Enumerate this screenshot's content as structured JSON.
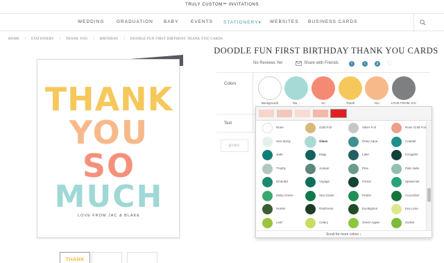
{
  "header": {
    "brand": "TRULY CUSTOM™ INVITATIONS"
  },
  "nav": {
    "items": [
      "WEDDING",
      "GRADUATION",
      "BABY",
      "EVENTS",
      "STATIONERY",
      "WEBSITES",
      "BUSINESS CARDS"
    ],
    "active": "STATIONERY",
    "active_suffix": "▾",
    "search_icon": "search-icon"
  },
  "breadcrumb": [
    "HOME",
    "/",
    "STATIONERY",
    "/",
    "THANK YOU",
    "/",
    "BIRTHDAY",
    "/",
    "DOODLE FUN FIRST BIRTHDAY THANK YOU CARDS"
  ],
  "card": {
    "line1": "THANK",
    "line2": "YOU",
    "line3": "SO",
    "line4": "MUCH",
    "signoff": "LOVE FROM JAC & BLAKE"
  },
  "thumbnails": {
    "first": "THANK"
  },
  "product": {
    "title": "DOODLE FUN FIRST BIRTHDAY THANK YOU CARDS",
    "reviews": "No Reviews Yet",
    "share": "Share with Friends",
    "social": [
      "f",
      "t",
      "p"
    ],
    "favorite_icon": "heart-icon"
  },
  "options": {
    "colors_label": "Colors",
    "text_label": "Text",
    "prev_label": "prev",
    "swatches": [
      {
        "label": "Background",
        "color": "#ffffff"
      },
      {
        "label": "Mu...",
        "color": "#a5dad6"
      },
      {
        "label": "So",
        "color": "#f48a74"
      },
      {
        "label": "Thank",
        "color": "#f6c85c"
      },
      {
        "label": "You",
        "color": "#f8b98a"
      },
      {
        "label": "LOVE FROM JAC",
        "color": "#7d7f80"
      }
    ]
  },
  "picker": {
    "strip_colors": [
      "#f6d5cc",
      "#f3c8bc",
      "#f7dcd2",
      "#f2b9a8",
      "#e41d23"
    ],
    "colors": [
      {
        "name": "None",
        "color": "#ffffff",
        "bold": false
      },
      {
        "name": "Gold Foil",
        "color": "#d8b97a",
        "bold": false
      },
      {
        "name": "Silver Foil",
        "color": "#c7c7c7",
        "bold": false
      },
      {
        "name": "Rose Gold Foil",
        "color": "#eba08a",
        "bold": false
      },
      {
        "name": "Sea Spray",
        "color": "#e4f1ea",
        "bold": false
      },
      {
        "name": "Glass",
        "color": "#a5dad6",
        "bold": true
      },
      {
        "name": "Deep Aqua",
        "color": "#3d8f94",
        "bold": false
      },
      {
        "name": "Coastal",
        "color": "#1e8f8b",
        "bold": false
      },
      {
        "name": "Jade",
        "color": "#0f7e76",
        "bold": false
      },
      {
        "name": "Edgy",
        "color": "#13625d",
        "bold": false
      },
      {
        "name": "Lake",
        "color": "#245e62",
        "bold": false
      },
      {
        "name": "Incognito",
        "color": "#133f3c",
        "bold": false
      },
      {
        "name": "Trophy",
        "color": "#b1c7c1",
        "bold": false
      },
      {
        "name": "Juniper",
        "color": "#5e867c",
        "bold": false
      },
      {
        "name": "Pine",
        "color": "#6a9b8c",
        "bold": false
      },
      {
        "name": "Pale Jade",
        "color": "#90c2ae",
        "bold": false
      },
      {
        "name": "Emerald",
        "color": "#1b8a6e",
        "bold": false
      },
      {
        "name": "Voyage",
        "color": "#0f6e5a",
        "bold": false
      },
      {
        "name": "Forest",
        "color": "#154335",
        "bold": false
      },
      {
        "name": "Spearmint",
        "color": "#2aa379",
        "bold": false
      },
      {
        "name": "Minty Green",
        "color": "#38a86d",
        "bold": false
      },
      {
        "name": "Sea Grass",
        "color": "#0f7a4a",
        "bold": false
      },
      {
        "name": "Prairie",
        "color": "#1f9154",
        "bold": false
      },
      {
        "name": "Cucumber",
        "color": "#16753c",
        "bold": false
      },
      {
        "name": "Hunter",
        "color": "#3a5f34",
        "bold": false
      },
      {
        "name": "Rainforest",
        "color": "#1b3d22",
        "bold": false
      },
      {
        "name": "Eucalyptus",
        "color": "#1f4d26",
        "bold": false
      },
      {
        "name": "Key Lime",
        "color": "#dde88e",
        "bold": false
      },
      {
        "name": "Leaf",
        "color": "#9cc23f",
        "bold": false
      },
      {
        "name": "Celery",
        "color": "#c9dc62",
        "bold": false
      },
      {
        "name": "Green Apple",
        "color": "#8dc63f",
        "bold": false
      },
      {
        "name": "Sorbet",
        "color": "#7dbb3a",
        "bold": false
      }
    ],
    "scroll_more": "Scroll for more colors ↕"
  }
}
